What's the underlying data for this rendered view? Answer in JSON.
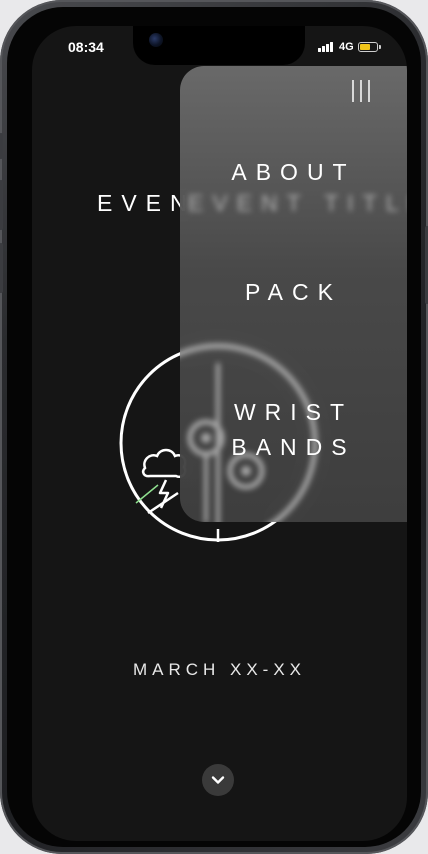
{
  "status_bar": {
    "time": "08:34",
    "network": "4G",
    "battery_color": "#f0c419"
  },
  "page": {
    "event_title_visible": "EVEN",
    "event_title_blurred": "EVENT TITLE",
    "date": "MARCH XX-XX",
    "scroll_icon": "chevron-down-icon",
    "logo_icon": "storm-windmill-logo"
  },
  "menu": {
    "toggle_icon": "menu-bars-icon",
    "items": [
      {
        "lines": [
          "ABOUT"
        ]
      },
      {
        "lines": [
          "PACK"
        ]
      },
      {
        "lines": [
          "WRIST",
          "BANDS"
        ]
      }
    ]
  },
  "colors": {
    "background": "#151515",
    "text": "#ffffff",
    "menu_panel": "#6e6e6e"
  }
}
